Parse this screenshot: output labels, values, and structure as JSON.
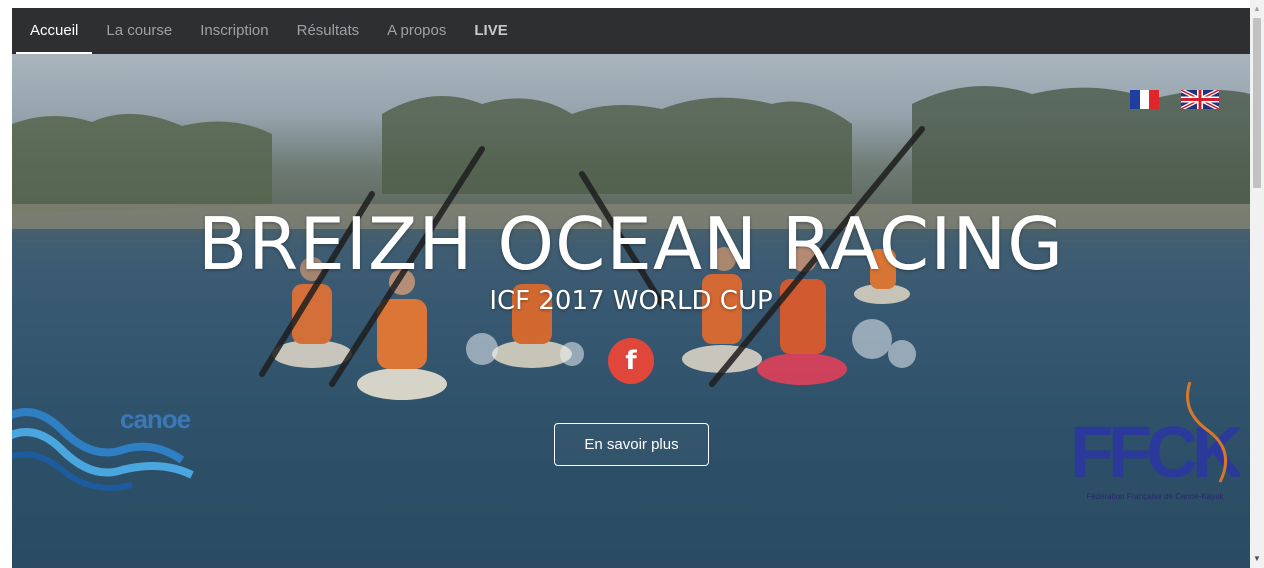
{
  "nav": {
    "items": [
      {
        "label": "Accueil"
      },
      {
        "label": "La course"
      },
      {
        "label": "Inscription"
      },
      {
        "label": "Résultats"
      },
      {
        "label": "A propos"
      },
      {
        "label": "LIVE"
      }
    ]
  },
  "hero": {
    "title": "BREIZH OCEAN RACING",
    "subtitle": "ICF 2017 WORLD CUP",
    "facebook_icon_label": "f",
    "more_button_label": "En savoir plus"
  },
  "flags": {
    "french": "flag-fr-icon",
    "english": "flag-uk-icon"
  },
  "logos": {
    "canoe_text": "canoe",
    "ffck_caption": "Fédération Française de Canoë-Kayak"
  },
  "colors": {
    "navbar_bg": "#2e2f31",
    "facebook_red": "#e0473a",
    "nav_inactive": "#9da1a6"
  }
}
